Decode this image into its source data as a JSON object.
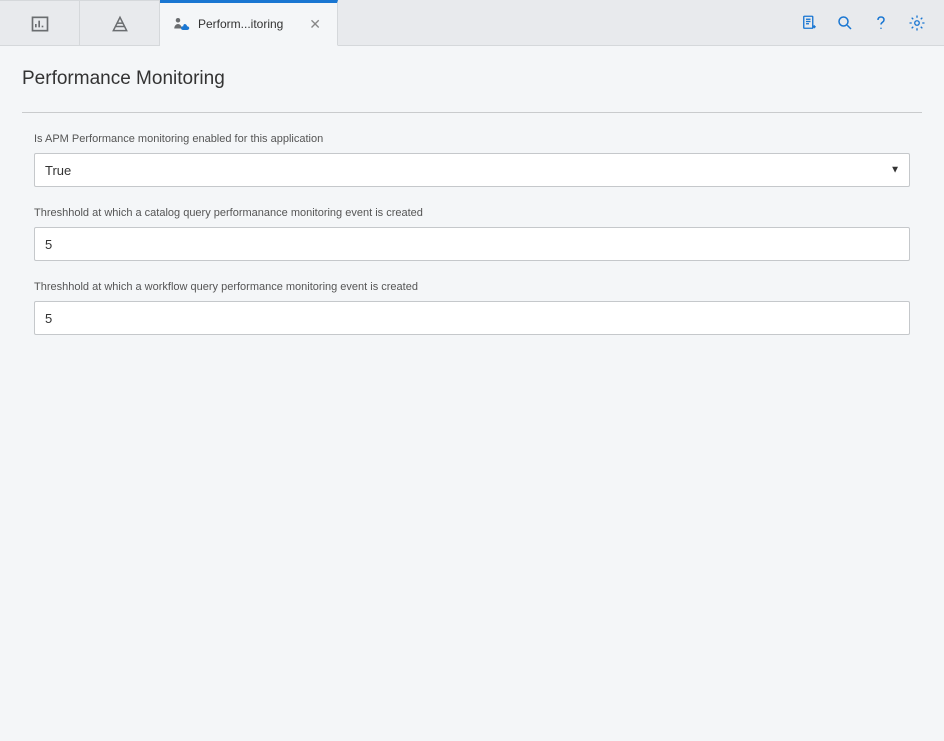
{
  "tabs": {
    "active_label": "Perform...itoring"
  },
  "toolbar": {},
  "page": {
    "title": "Performance Monitoring"
  },
  "form": {
    "apm_enabled": {
      "label": "Is APM Performance monitoring enabled for this application",
      "value": "True"
    },
    "catalog_threshold": {
      "label": "Threshhold at which a catalog query performanance monitoring event is created",
      "value": "5"
    },
    "workflow_threshold": {
      "label": "Threshhold at which a workflow query performance monitoring event is created",
      "value": "5"
    }
  }
}
